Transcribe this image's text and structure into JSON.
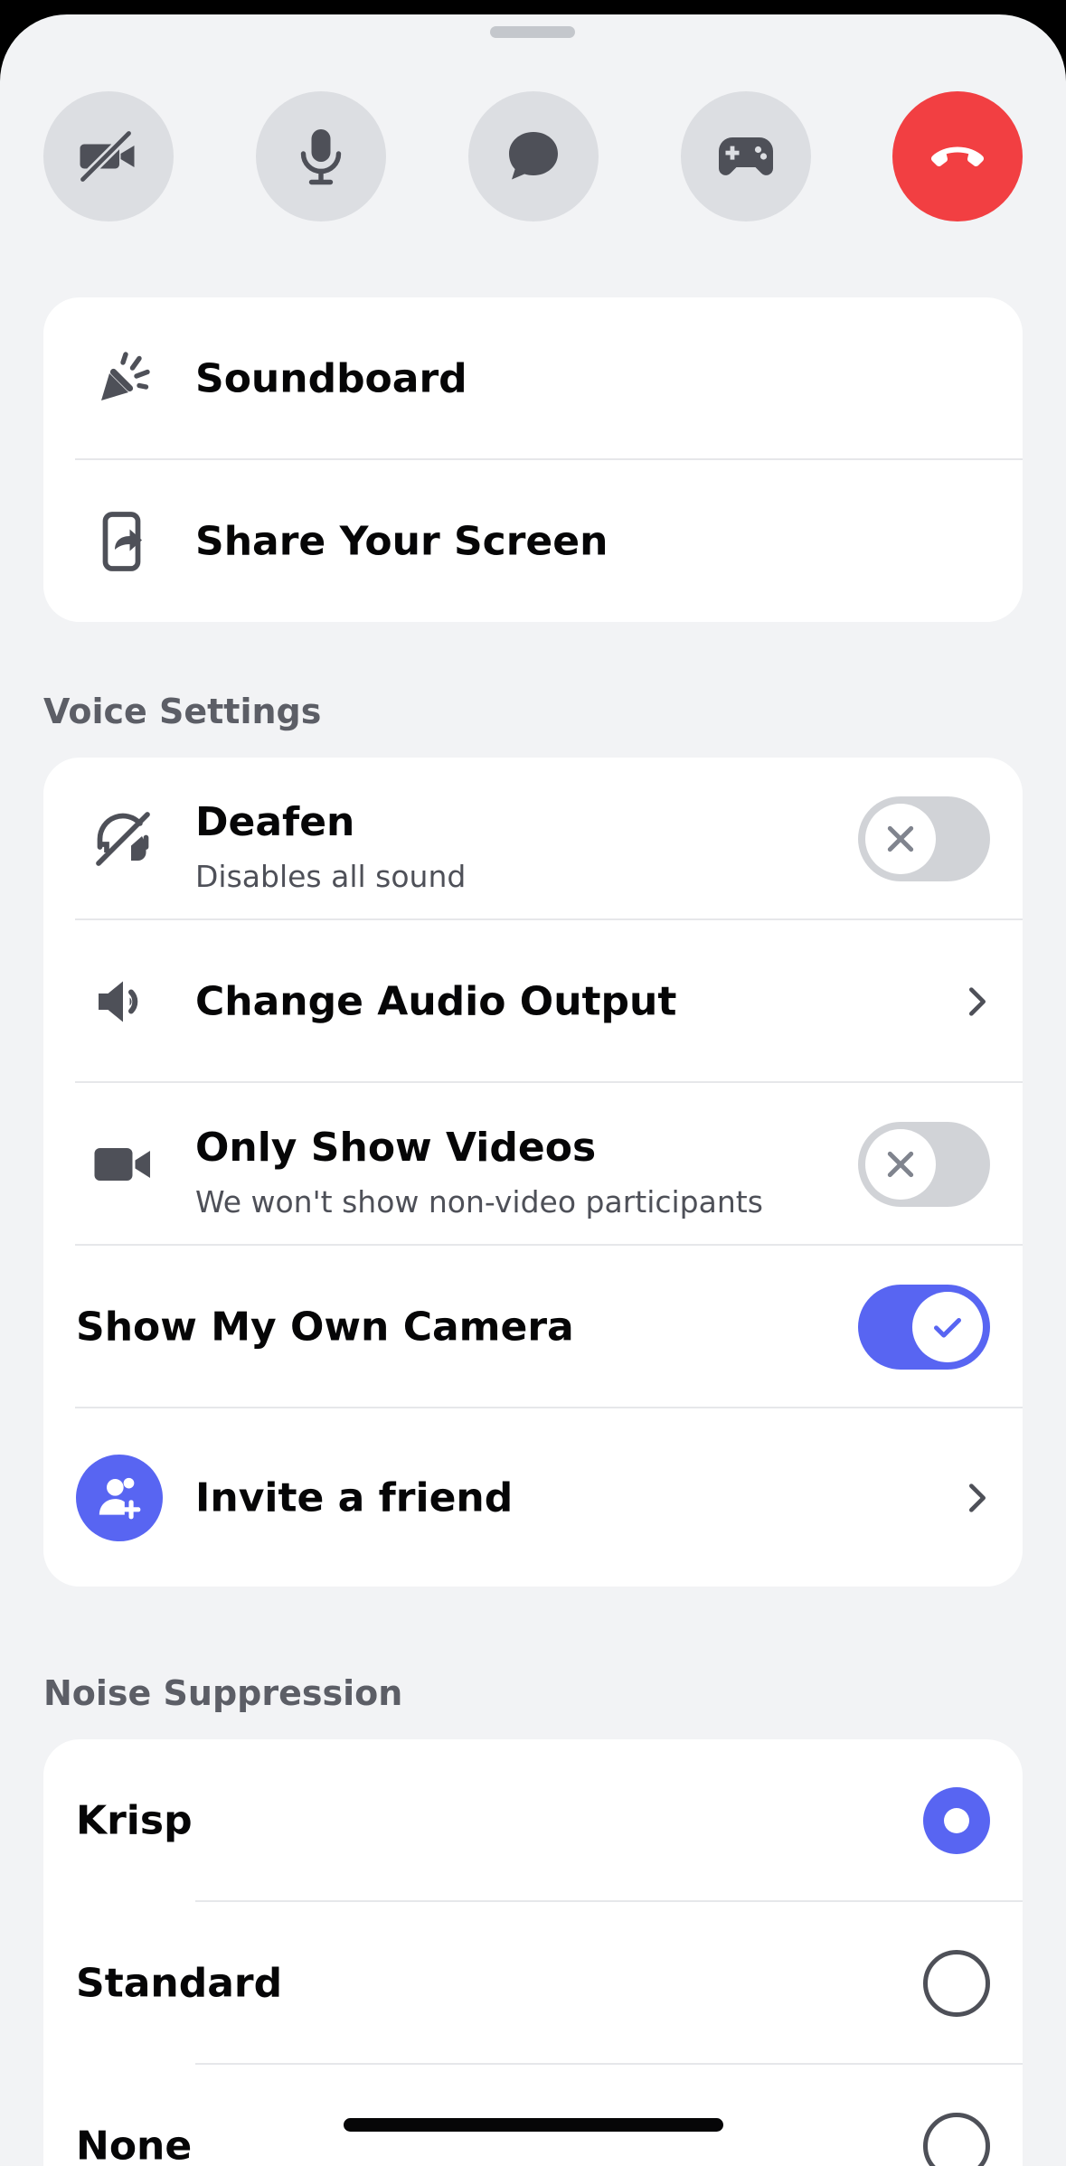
{
  "top_buttons": [
    {
      "icon": "camera-off-icon",
      "name": "camera-toggle-button"
    },
    {
      "icon": "microphone-icon",
      "name": "mute-button"
    },
    {
      "icon": "chat-bubble-icon",
      "name": "chat-button"
    },
    {
      "icon": "gamepad-icon",
      "name": "activities-button"
    },
    {
      "icon": "hang-up-icon",
      "name": "leave-call-button"
    }
  ],
  "actions": {
    "soundboard": "Soundboard",
    "share_screen": "Share Your Screen"
  },
  "voice_settings": {
    "label": "Voice Settings",
    "deafen": {
      "title": "Deafen",
      "subtitle": "Disables all sound",
      "enabled": false
    },
    "audio_output": {
      "title": "Change Audio Output"
    },
    "only_videos": {
      "title": "Only Show Videos",
      "subtitle": "We won't show non-video participants",
      "enabled": false
    },
    "own_camera": {
      "title": "Show My Own Camera",
      "enabled": true
    },
    "invite": {
      "title": "Invite a friend"
    }
  },
  "noise_suppression": {
    "label": "Noise Suppression",
    "options": [
      "Krisp",
      "Standard",
      "None"
    ],
    "selected": "Krisp"
  },
  "colors": {
    "accent": "#5865f2",
    "danger": "#f23f42",
    "icon": "#4e5058"
  }
}
